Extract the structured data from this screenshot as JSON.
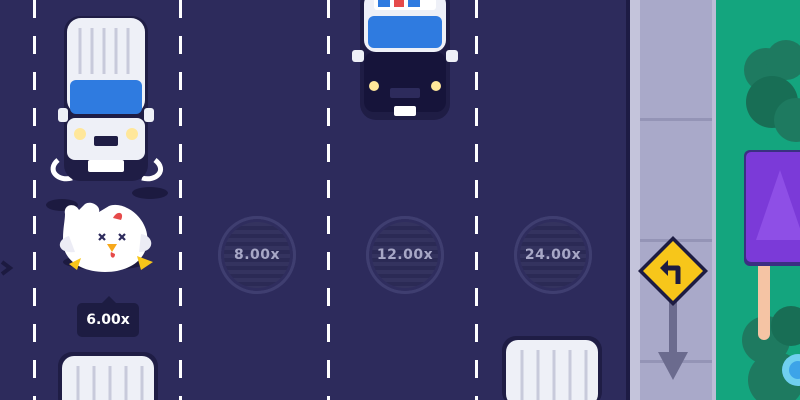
{
  "game": {
    "current_multiplier": "6.00x",
    "multipliers": [
      "8.00x",
      "12.00x",
      "24.00x"
    ]
  },
  "colors": {
    "road": "#2d2b5c",
    "lane_line": "#ffffff",
    "sidewalk": "#a9a9c9",
    "grass": "#14a57e",
    "truck_windshield": "#2f7be0",
    "sign": "#f7c61a",
    "umbrella": "#7b3ad8"
  },
  "icons": [
    "chicken-icon",
    "turn-left-arrow-icon",
    "down-arrow-icon",
    "police-light-icon"
  ]
}
